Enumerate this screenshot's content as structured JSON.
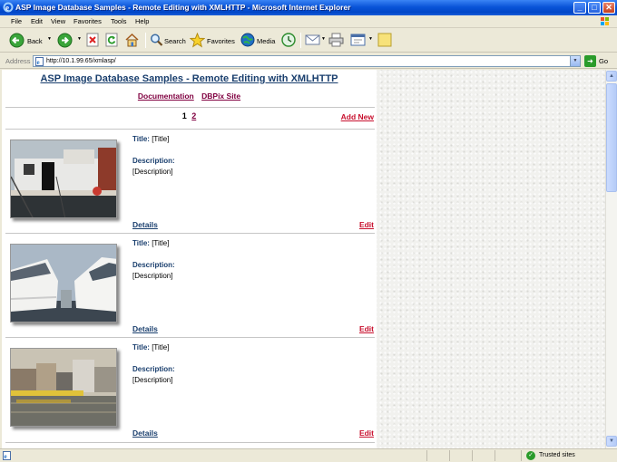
{
  "window": {
    "title": "ASP Image Database Samples - Remote Editing with XMLHTTP - Microsoft Internet Explorer",
    "minimize": "_",
    "maximize": "□",
    "close": "✕"
  },
  "menu": [
    "File",
    "Edit",
    "View",
    "Favorites",
    "Tools",
    "Help"
  ],
  "toolbar": {
    "back": "Back",
    "search": "Search",
    "favorites": "Favorites",
    "media": "Media"
  },
  "address": {
    "label": "Address",
    "url": "http://10.1.99.65/xmlasp/",
    "go": "Go"
  },
  "page": {
    "title": "ASP Image Database Samples - Remote Editing with XMLHTTP",
    "links": [
      "Documentation",
      "DBPix Site"
    ],
    "pager": {
      "current": "1",
      "next": "2"
    },
    "add_new": "Add New",
    "records": [
      {
        "title_label": "Title:",
        "title": "[Title]",
        "desc_label": "Description:",
        "desc": "[Description]",
        "details": "Details",
        "edit": "Edit",
        "image": "ship"
      },
      {
        "title_label": "Title:",
        "title": "[Title]",
        "desc_label": "Description:",
        "desc": "[Description]",
        "details": "Details",
        "edit": "Edit",
        "image": "yachts"
      },
      {
        "title_label": "Title:",
        "title": "[Title]",
        "desc_label": "Description:",
        "desc": "[Description]",
        "details": "Details",
        "edit": "Edit",
        "image": "waterfront"
      }
    ]
  },
  "status": {
    "zone": "Trusted sites"
  },
  "colors": {
    "titlebar": "#0a54d8",
    "heading": "#1a3f6e",
    "link": "#800040",
    "edit": "#c8102e"
  }
}
